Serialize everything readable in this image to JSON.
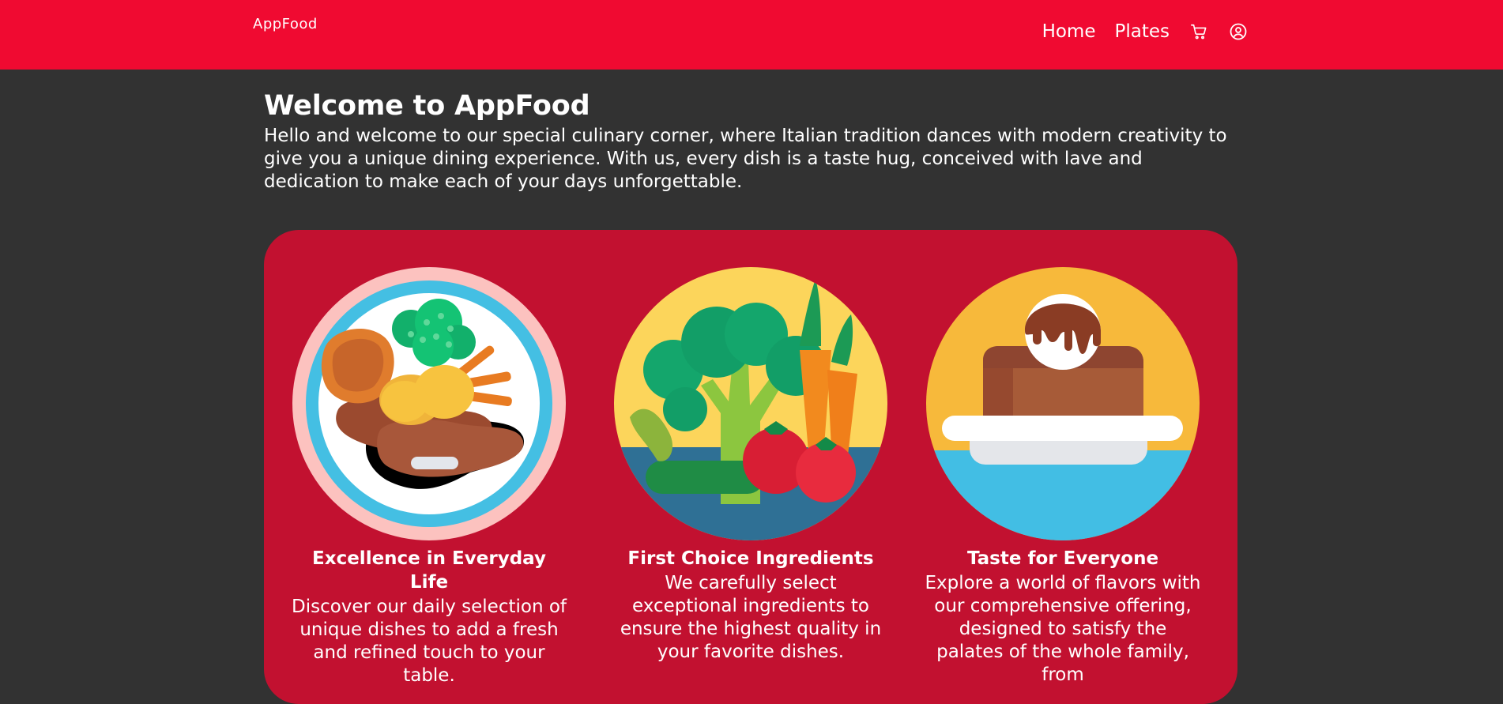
{
  "header": {
    "brand": "AppFood",
    "nav": [
      {
        "label": "Home"
      },
      {
        "label": "Plates"
      }
    ],
    "icons": [
      "cart-icon",
      "user-icon"
    ],
    "background": "#F00A31"
  },
  "intro": {
    "title": "Welcome to AppFood",
    "text": "Hello and welcome to our special culinary corner, where Italian tradition dances with modern creativity to give you a unique dining experience. With us, every dish is a taste hug, conceived with lave and dedication to make each of your days unforgettable."
  },
  "features": [
    {
      "title": "Excellence in Everyday Life",
      "text": "Discover our daily selection of unique dishes to add a fresh and refined touch to your table.",
      "image": "plate-illustration"
    },
    {
      "title": "First Choice Ingredients",
      "text": "We carefully select exceptional ingredients to ensure the highest quality in your favorite dishes.",
      "image": "vegetables-illustration"
    },
    {
      "title": "Taste for Everyone",
      "text": "Explore a world of flavors with our comprehensive offering, designed to satisfy the palates of the whole family, from",
      "image": "dessert-illustration"
    }
  ],
  "colors": {
    "page_background": "#323232",
    "card_background": "#C21130",
    "accent": "#F00A31"
  }
}
